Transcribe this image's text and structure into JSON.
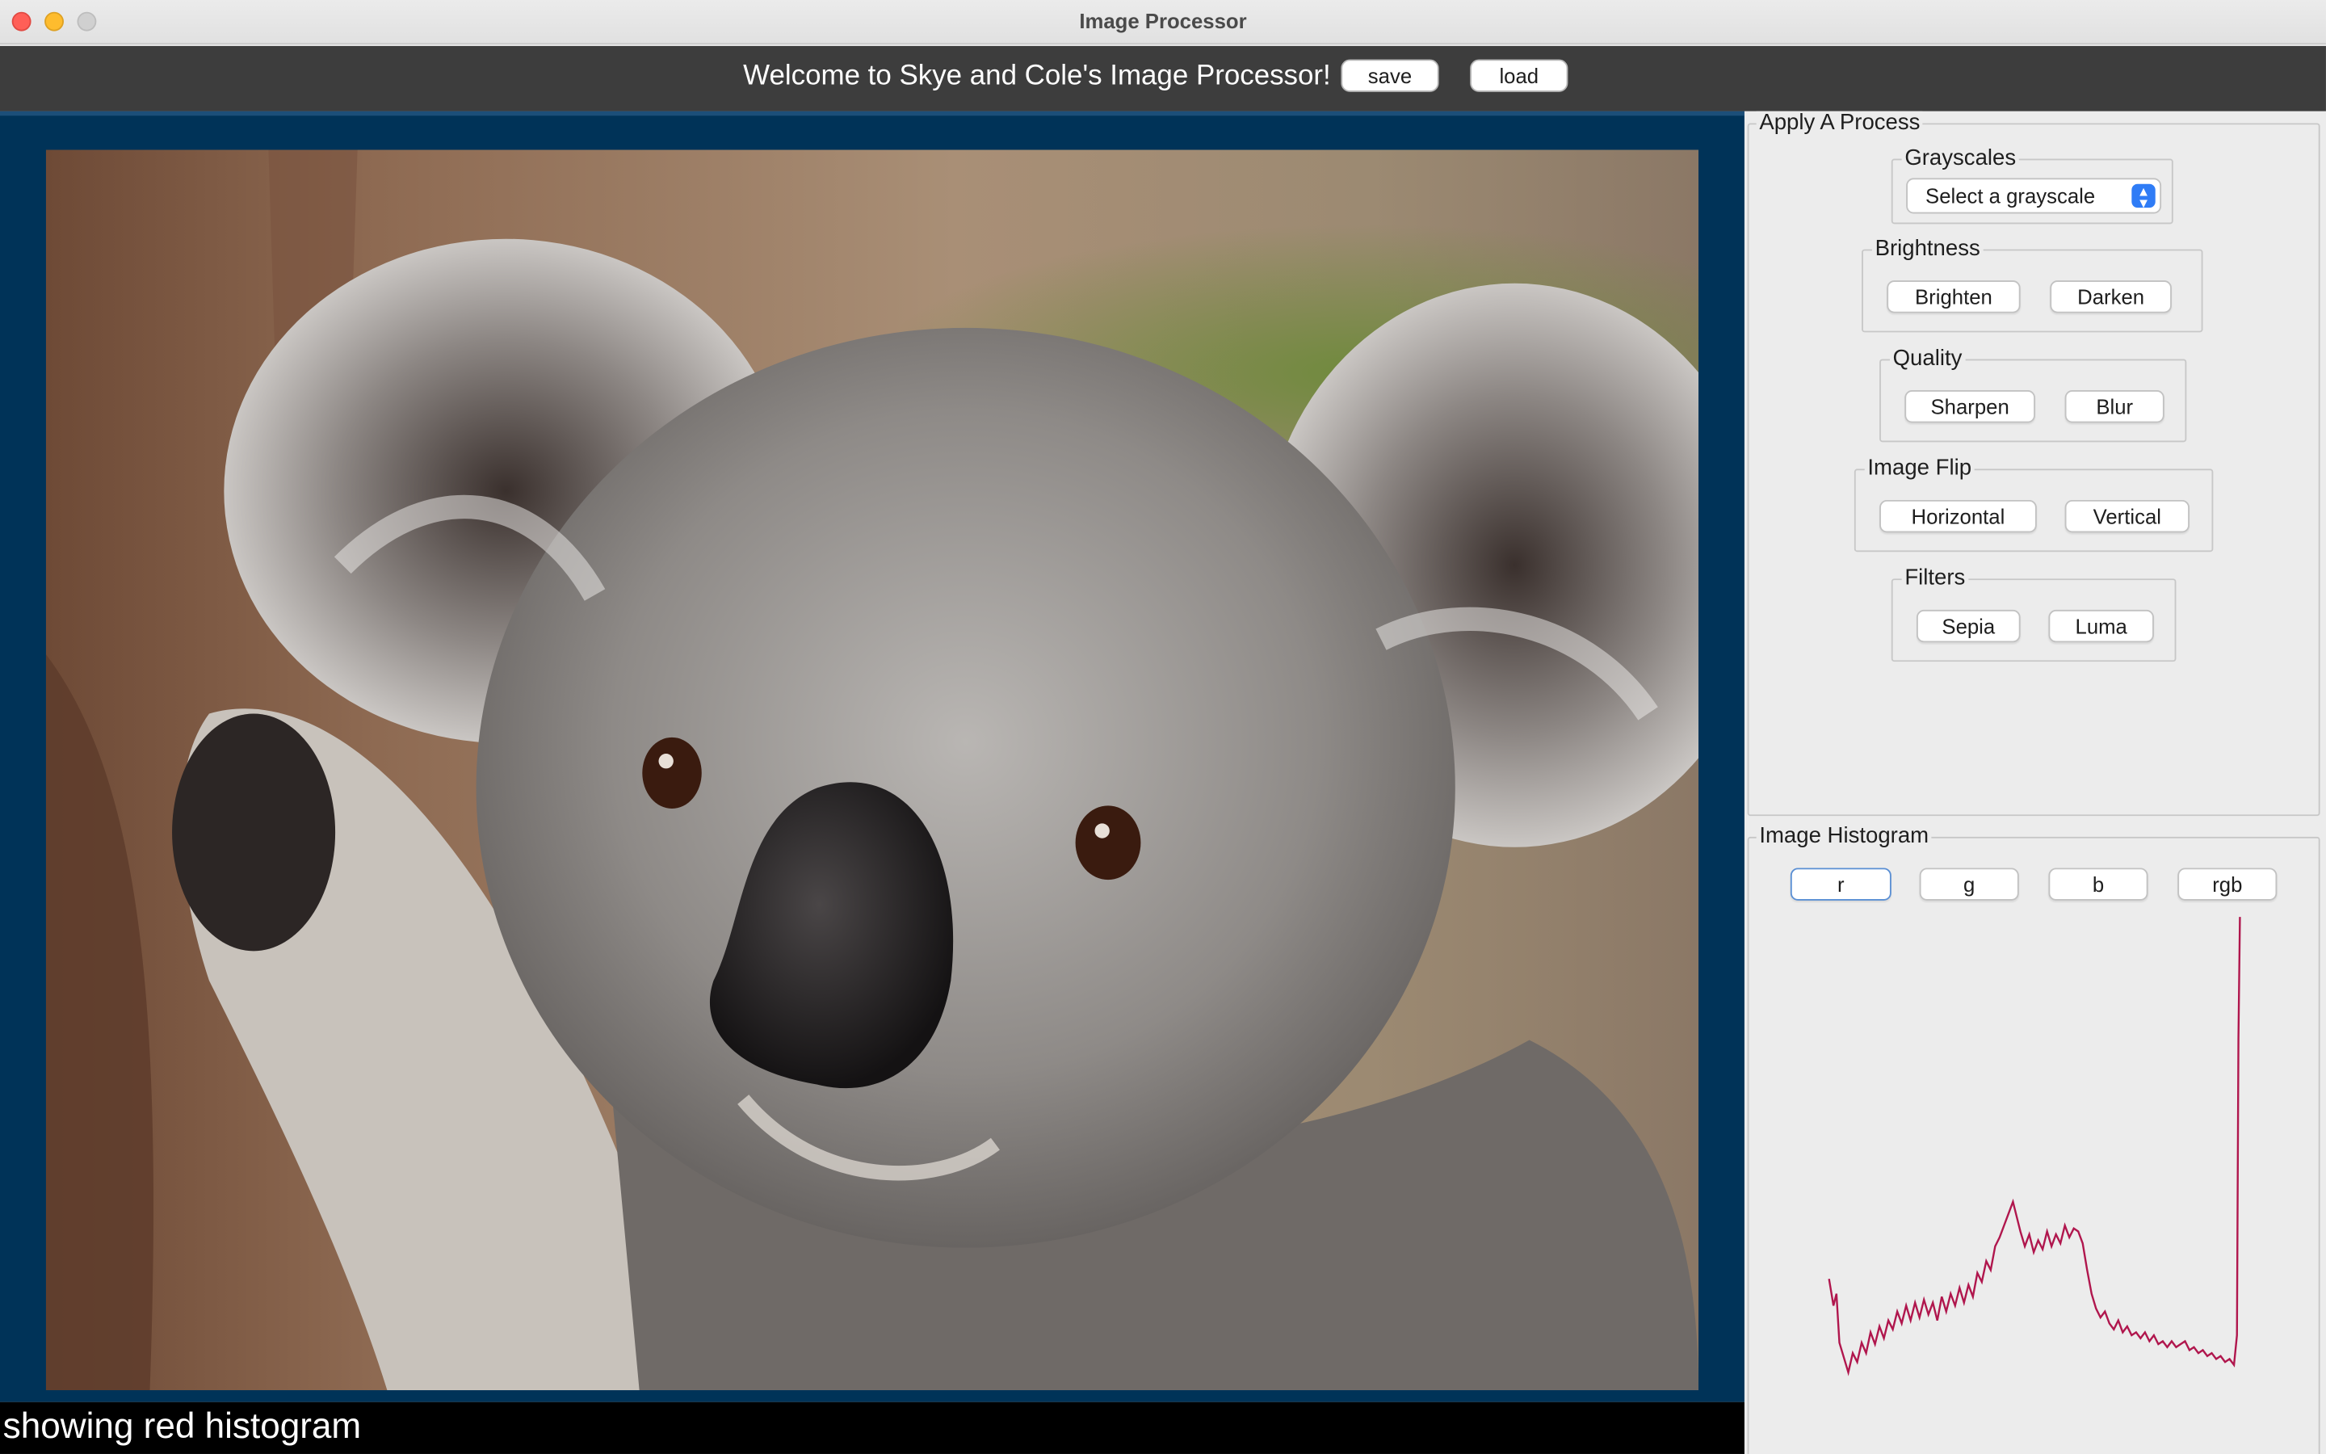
{
  "window": {
    "title": "Image Processor"
  },
  "header": {
    "welcome": "Welcome to Skye and Cole's Image Processor!",
    "save_label": "save",
    "load_label": "load"
  },
  "status": {
    "text": "showing red histogram"
  },
  "process_panel": {
    "title": "Apply A Process",
    "grayscales": {
      "title": "Grayscales",
      "selected": "Select a grayscale"
    },
    "brightness": {
      "title": "Brightness",
      "brighten": "Brighten",
      "darken": "Darken"
    },
    "quality": {
      "title": "Quality",
      "sharpen": "Sharpen",
      "blur": "Blur"
    },
    "flip": {
      "title": "Image Flip",
      "horizontal": "Horizontal",
      "vertical": "Vertical"
    },
    "filters": {
      "title": "Filters",
      "sepia": "Sepia",
      "luma": "Luma"
    }
  },
  "histogram_panel": {
    "title": "Image Histogram",
    "buttons": [
      "r",
      "g",
      "b",
      "rgb"
    ],
    "active_button": "r",
    "line_color": "#b0164d"
  },
  "image": {
    "subject": "koala photograph"
  },
  "colors": {
    "image_bg": "#003358",
    "header_bg": "#3d3d3d",
    "status_bg": "#000000"
  }
}
